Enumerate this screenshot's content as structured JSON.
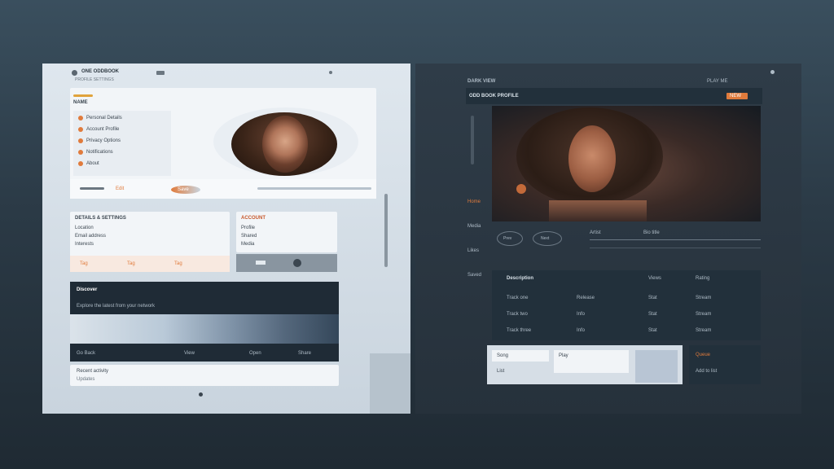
{
  "left_panel": {
    "top_bar_label": "ONE ODDBOOK",
    "page_title": "PROFILE SETTINGS",
    "card1": {
      "title": "NAME",
      "items": [
        "Personal Details",
        "Account Profile",
        "Privacy Options",
        "Notifications",
        "About"
      ],
      "footer_items": [
        "Edit",
        "Save"
      ]
    },
    "card2": {
      "title": "DETAILS & SETTINGS",
      "rows": [
        "Location",
        "Email address",
        "Interests"
      ],
      "tags": [
        "Tag",
        "Tag",
        "Tag"
      ],
      "side_title": "ACCOUNT",
      "side_rows": [
        "Profile",
        "Shared",
        "Media"
      ]
    },
    "gallery": {
      "title": "Discover",
      "subtitle": "Explore the latest from your network",
      "footer_label": "Go Back",
      "footer_buttons": [
        "View",
        "Open",
        "Share"
      ]
    },
    "bottom_rows": [
      "Recent activity",
      "Updates"
    ]
  },
  "right_panel": {
    "top_bar_left": "DARK VIEW",
    "top_bar_right": "PLAY ME",
    "header_label": "ODD BOOK PROFILE",
    "header_badge": "NEW",
    "side_labels": [
      "Home",
      "Media",
      "Likes",
      "Saved"
    ],
    "circle_buttons": [
      "Prev",
      "Next"
    ],
    "info_label": "Artist",
    "info_value": "Bio title",
    "table": {
      "headers": [
        "Description",
        "Views",
        "Rating"
      ],
      "rows": [
        [
          "Track one",
          "Release",
          "Stat",
          "Stream"
        ],
        [
          "Track two",
          "Info",
          "Stat",
          "Stream"
        ],
        [
          "Track three",
          "Info",
          "Stat",
          "Stream"
        ]
      ]
    },
    "bottom_cards": [
      "Song",
      "Play",
      "List"
    ],
    "bottom_side": [
      "Queue",
      "Add to list"
    ]
  }
}
